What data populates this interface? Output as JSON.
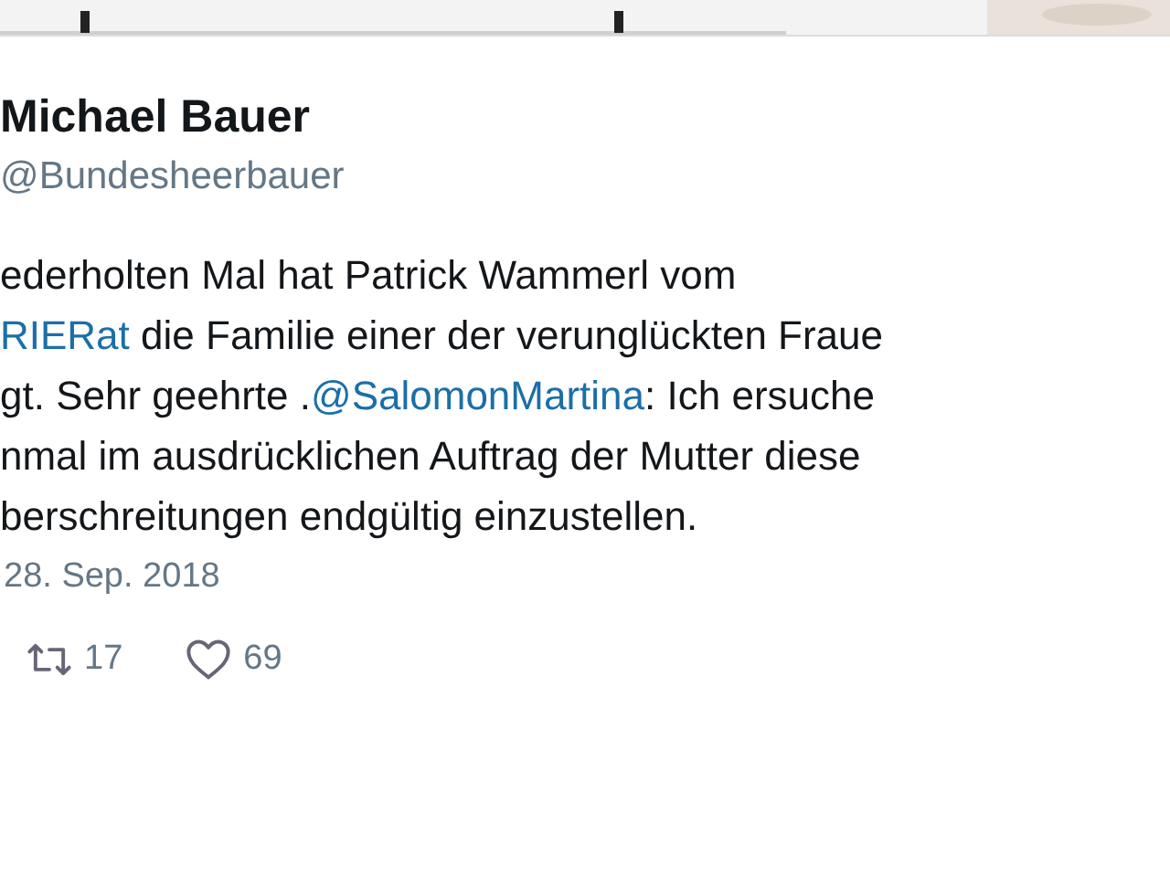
{
  "header_strip": {
    "kind": "picture"
  },
  "author": {
    "name": "Michael Bauer",
    "handle": "@Bundesheerbauer"
  },
  "tweet_lines": [
    [
      {
        "kind": "text",
        "text": "ederholten Mal hat Patrick Wammerl vom"
      }
    ],
    [
      {
        "kind": "link",
        "text": "RIERat"
      },
      {
        "kind": "text",
        "text": " die Familie einer der verunglückten Fraue"
      }
    ],
    [
      {
        "kind": "text",
        "text": "gt. Sehr geehrte ."
      },
      {
        "kind": "link",
        "text": "@SalomonMartina"
      },
      {
        "kind": "text",
        "text": ": Ich ersuche"
      }
    ],
    [
      {
        "kind": "text",
        "text": "nmal im ausdrücklichen Auftrag der Mutter diese"
      }
    ],
    [
      {
        "kind": "text",
        "text": "berschreitungen endgültig einzustellen."
      }
    ]
  ],
  "date": "28. Sep. 2018",
  "actions": [
    {
      "kind": "retweet",
      "count": "17"
    },
    {
      "kind": "like",
      "count": "69"
    }
  ]
}
